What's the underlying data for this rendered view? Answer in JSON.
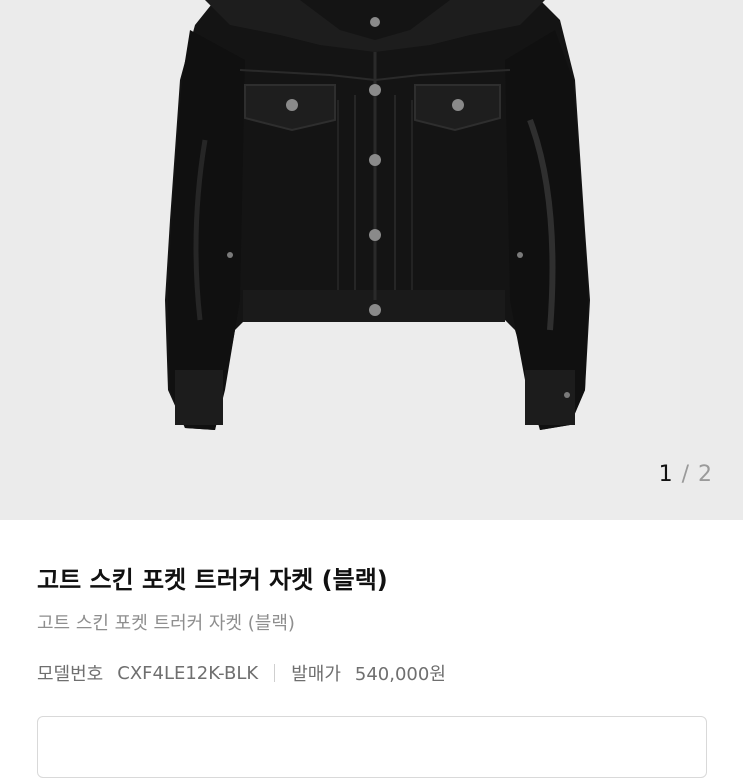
{
  "gallery": {
    "image_description_icon": "leather-jacket-photo",
    "pager": {
      "current": "1",
      "separator": "/",
      "total": "2"
    }
  },
  "product": {
    "title": "고트 스킨 포켓 트러커 자켓 (블랙)",
    "subtitle": "고트 스킨 포켓 트러커 자켓 (블랙)",
    "model_label": "모델번호",
    "model_value": "CXF4LE12K-BLK",
    "release_price_label": "발매가",
    "release_price_value": "540,000원"
  },
  "bottom_box": {
    "label": ""
  },
  "colors": {
    "gallery_bg": "#ebebeb",
    "jacket": "#141414",
    "muted_text": "#8e8e8e"
  }
}
